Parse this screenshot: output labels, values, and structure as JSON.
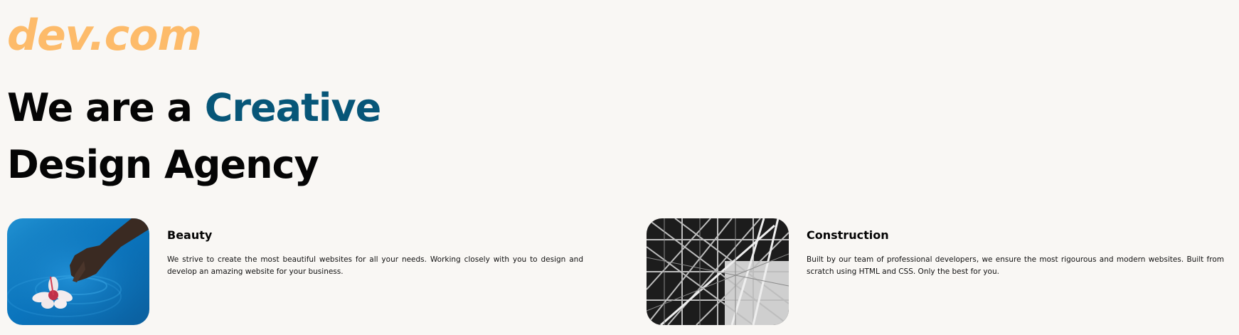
{
  "logo": {
    "text": "dev.com",
    "color": "#fdbb6a"
  },
  "hero": {
    "line1_prefix": "We are a ",
    "line1_accent": "Creative",
    "line2": "Design Agency",
    "accent_color": "#075678"
  },
  "services": [
    {
      "title": "Beauty",
      "text": "We strive to create the most beautiful websites for all your needs. Working closely with you to design and develop an amazing website for your business.",
      "image": "hand-touching-water-with-flower-image"
    },
    {
      "title": "Construction",
      "text": "Built by our team of professional developers, we ensure the most rigourous and modern websites. Built from scratch using HTML and CSS. Only the best for you.",
      "image": "steel-structure-black-white-image"
    }
  ]
}
